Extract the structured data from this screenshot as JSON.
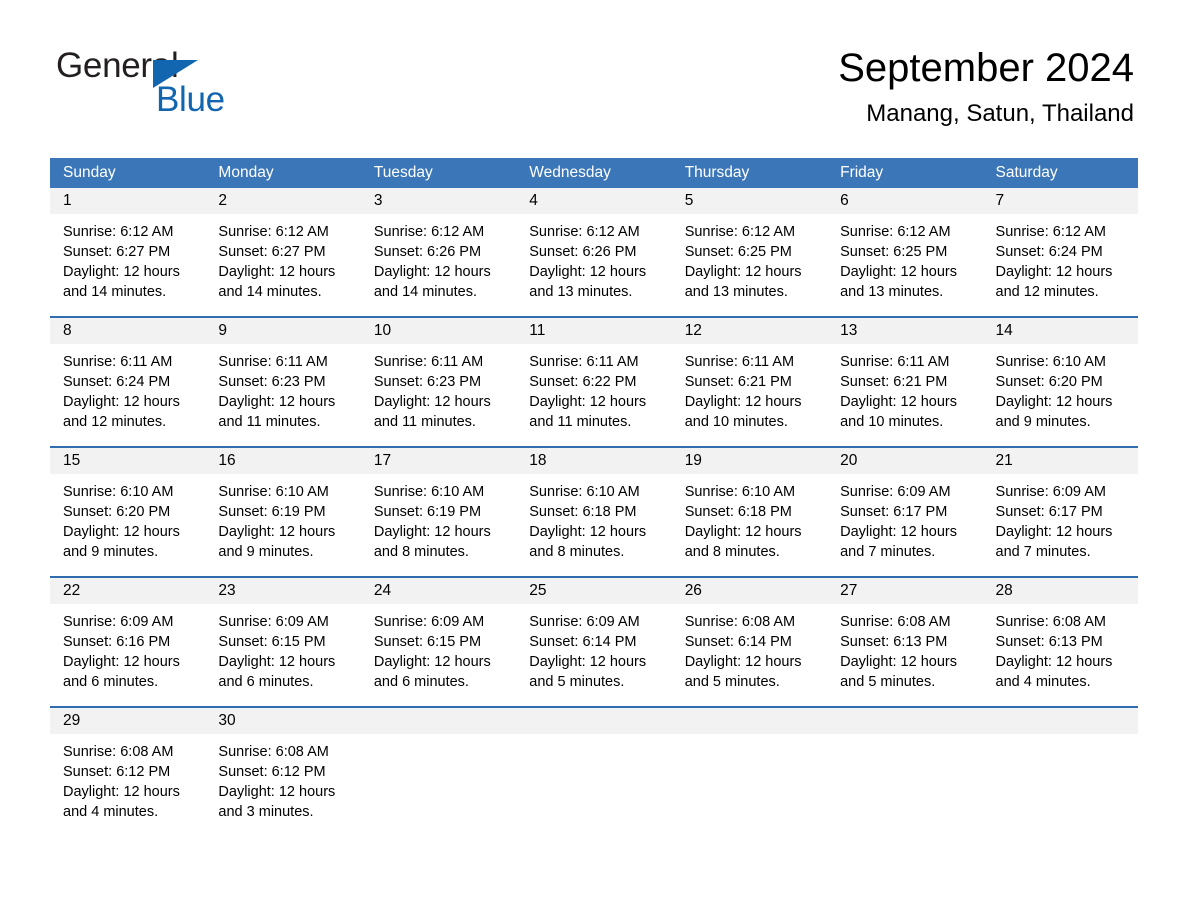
{
  "brand": {
    "name_part1": "General",
    "name_part2": "Blue",
    "triangle_color": "#1266b0",
    "icon": "triangle-icon"
  },
  "header": {
    "month_title": "September 2024",
    "location": "Manang, Satun, Thailand"
  },
  "colors": {
    "header_blue": "#3b77b8",
    "row_divider_blue": "#2f6dae",
    "day_number_bg": "#f2f2f2",
    "brand_blue": "#1266b0"
  },
  "weekdays": [
    "Sunday",
    "Monday",
    "Tuesday",
    "Wednesday",
    "Thursday",
    "Friday",
    "Saturday"
  ],
  "weeks": [
    [
      {
        "day": "1",
        "sunrise": "Sunrise: 6:12 AM",
        "sunset": "Sunset: 6:27 PM",
        "daylight_line1": "Daylight: 12 hours",
        "daylight_line2": "and 14 minutes."
      },
      {
        "day": "2",
        "sunrise": "Sunrise: 6:12 AM",
        "sunset": "Sunset: 6:27 PM",
        "daylight_line1": "Daylight: 12 hours",
        "daylight_line2": "and 14 minutes."
      },
      {
        "day": "3",
        "sunrise": "Sunrise: 6:12 AM",
        "sunset": "Sunset: 6:26 PM",
        "daylight_line1": "Daylight: 12 hours",
        "daylight_line2": "and 14 minutes."
      },
      {
        "day": "4",
        "sunrise": "Sunrise: 6:12 AM",
        "sunset": "Sunset: 6:26 PM",
        "daylight_line1": "Daylight: 12 hours",
        "daylight_line2": "and 13 minutes."
      },
      {
        "day": "5",
        "sunrise": "Sunrise: 6:12 AM",
        "sunset": "Sunset: 6:25 PM",
        "daylight_line1": "Daylight: 12 hours",
        "daylight_line2": "and 13 minutes."
      },
      {
        "day": "6",
        "sunrise": "Sunrise: 6:12 AM",
        "sunset": "Sunset: 6:25 PM",
        "daylight_line1": "Daylight: 12 hours",
        "daylight_line2": "and 13 minutes."
      },
      {
        "day": "7",
        "sunrise": "Sunrise: 6:12 AM",
        "sunset": "Sunset: 6:24 PM",
        "daylight_line1": "Daylight: 12 hours",
        "daylight_line2": "and 12 minutes."
      }
    ],
    [
      {
        "day": "8",
        "sunrise": "Sunrise: 6:11 AM",
        "sunset": "Sunset: 6:24 PM",
        "daylight_line1": "Daylight: 12 hours",
        "daylight_line2": "and 12 minutes."
      },
      {
        "day": "9",
        "sunrise": "Sunrise: 6:11 AM",
        "sunset": "Sunset: 6:23 PM",
        "daylight_line1": "Daylight: 12 hours",
        "daylight_line2": "and 11 minutes."
      },
      {
        "day": "10",
        "sunrise": "Sunrise: 6:11 AM",
        "sunset": "Sunset: 6:23 PM",
        "daylight_line1": "Daylight: 12 hours",
        "daylight_line2": "and 11 minutes."
      },
      {
        "day": "11",
        "sunrise": "Sunrise: 6:11 AM",
        "sunset": "Sunset: 6:22 PM",
        "daylight_line1": "Daylight: 12 hours",
        "daylight_line2": "and 11 minutes."
      },
      {
        "day": "12",
        "sunrise": "Sunrise: 6:11 AM",
        "sunset": "Sunset: 6:21 PM",
        "daylight_line1": "Daylight: 12 hours",
        "daylight_line2": "and 10 minutes."
      },
      {
        "day": "13",
        "sunrise": "Sunrise: 6:11 AM",
        "sunset": "Sunset: 6:21 PM",
        "daylight_line1": "Daylight: 12 hours",
        "daylight_line2": "and 10 minutes."
      },
      {
        "day": "14",
        "sunrise": "Sunrise: 6:10 AM",
        "sunset": "Sunset: 6:20 PM",
        "daylight_line1": "Daylight: 12 hours",
        "daylight_line2": "and 9 minutes."
      }
    ],
    [
      {
        "day": "15",
        "sunrise": "Sunrise: 6:10 AM",
        "sunset": "Sunset: 6:20 PM",
        "daylight_line1": "Daylight: 12 hours",
        "daylight_line2": "and 9 minutes."
      },
      {
        "day": "16",
        "sunrise": "Sunrise: 6:10 AM",
        "sunset": "Sunset: 6:19 PM",
        "daylight_line1": "Daylight: 12 hours",
        "daylight_line2": "and 9 minutes."
      },
      {
        "day": "17",
        "sunrise": "Sunrise: 6:10 AM",
        "sunset": "Sunset: 6:19 PM",
        "daylight_line1": "Daylight: 12 hours",
        "daylight_line2": "and 8 minutes."
      },
      {
        "day": "18",
        "sunrise": "Sunrise: 6:10 AM",
        "sunset": "Sunset: 6:18 PM",
        "daylight_line1": "Daylight: 12 hours",
        "daylight_line2": "and 8 minutes."
      },
      {
        "day": "19",
        "sunrise": "Sunrise: 6:10 AM",
        "sunset": "Sunset: 6:18 PM",
        "daylight_line1": "Daylight: 12 hours",
        "daylight_line2": "and 8 minutes."
      },
      {
        "day": "20",
        "sunrise": "Sunrise: 6:09 AM",
        "sunset": "Sunset: 6:17 PM",
        "daylight_line1": "Daylight: 12 hours",
        "daylight_line2": "and 7 minutes."
      },
      {
        "day": "21",
        "sunrise": "Sunrise: 6:09 AM",
        "sunset": "Sunset: 6:17 PM",
        "daylight_line1": "Daylight: 12 hours",
        "daylight_line2": "and 7 minutes."
      }
    ],
    [
      {
        "day": "22",
        "sunrise": "Sunrise: 6:09 AM",
        "sunset": "Sunset: 6:16 PM",
        "daylight_line1": "Daylight: 12 hours",
        "daylight_line2": "and 6 minutes."
      },
      {
        "day": "23",
        "sunrise": "Sunrise: 6:09 AM",
        "sunset": "Sunset: 6:15 PM",
        "daylight_line1": "Daylight: 12 hours",
        "daylight_line2": "and 6 minutes."
      },
      {
        "day": "24",
        "sunrise": "Sunrise: 6:09 AM",
        "sunset": "Sunset: 6:15 PM",
        "daylight_line1": "Daylight: 12 hours",
        "daylight_line2": "and 6 minutes."
      },
      {
        "day": "25",
        "sunrise": "Sunrise: 6:09 AM",
        "sunset": "Sunset: 6:14 PM",
        "daylight_line1": "Daylight: 12 hours",
        "daylight_line2": "and 5 minutes."
      },
      {
        "day": "26",
        "sunrise": "Sunrise: 6:08 AM",
        "sunset": "Sunset: 6:14 PM",
        "daylight_line1": "Daylight: 12 hours",
        "daylight_line2": "and 5 minutes."
      },
      {
        "day": "27",
        "sunrise": "Sunrise: 6:08 AM",
        "sunset": "Sunset: 6:13 PM",
        "daylight_line1": "Daylight: 12 hours",
        "daylight_line2": "and 5 minutes."
      },
      {
        "day": "28",
        "sunrise": "Sunrise: 6:08 AM",
        "sunset": "Sunset: 6:13 PM",
        "daylight_line1": "Daylight: 12 hours",
        "daylight_line2": "and 4 minutes."
      }
    ],
    [
      {
        "day": "29",
        "sunrise": "Sunrise: 6:08 AM",
        "sunset": "Sunset: 6:12 PM",
        "daylight_line1": "Daylight: 12 hours",
        "daylight_line2": "and 4 minutes."
      },
      {
        "day": "30",
        "sunrise": "Sunrise: 6:08 AM",
        "sunset": "Sunset: 6:12 PM",
        "daylight_line1": "Daylight: 12 hours",
        "daylight_line2": "and 3 minutes."
      },
      {
        "day": "",
        "sunrise": "",
        "sunset": "",
        "daylight_line1": "",
        "daylight_line2": ""
      },
      {
        "day": "",
        "sunrise": "",
        "sunset": "",
        "daylight_line1": "",
        "daylight_line2": ""
      },
      {
        "day": "",
        "sunrise": "",
        "sunset": "",
        "daylight_line1": "",
        "daylight_line2": ""
      },
      {
        "day": "",
        "sunrise": "",
        "sunset": "",
        "daylight_line1": "",
        "daylight_line2": ""
      },
      {
        "day": "",
        "sunrise": "",
        "sunset": "",
        "daylight_line1": "",
        "daylight_line2": ""
      }
    ]
  ]
}
